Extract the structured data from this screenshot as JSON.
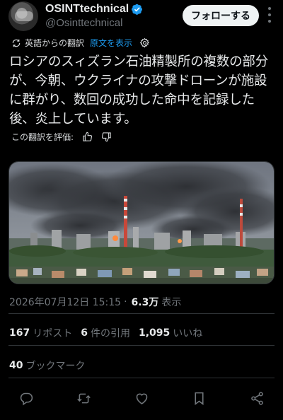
{
  "author": {
    "name": "OSINTtechnical",
    "handle": "@Osinttechnical",
    "verified": true,
    "follow_label": "フォローする"
  },
  "translation": {
    "label": "英語からの翻訳",
    "show_original": "原文を表示",
    "rate_label": "この翻訳を評価:"
  },
  "tweet": {
    "text": "ロシアのスィズラン石油精製所の複数の部分が、今朝、ウクライナの攻撃ドローンが施設に群がり、数回の成功した命中を記録した後、炎上しています。"
  },
  "meta": {
    "timestamp": "2026年07月12日 15:15",
    "separator": "·",
    "views_count": "6.3万",
    "views_label": "表示"
  },
  "stats": {
    "reposts_count": "167",
    "reposts_label": "リポスト",
    "quotes_count": "6",
    "quotes_label": "件の引用",
    "likes_count": "1,095",
    "likes_label": "いいね",
    "bookmarks_count": "40",
    "bookmarks_label": "ブックマーク"
  },
  "icons": {
    "verified": "verified-badge-icon",
    "more": "more-icon",
    "translate": "translate-icon",
    "settings": "gear-icon",
    "thumb_up": "thumb-up-icon",
    "thumb_down": "thumb-down-icon",
    "reply": "reply-icon",
    "repost": "repost-icon",
    "like": "like-icon",
    "bookmark": "bookmark-icon",
    "share": "share-icon"
  },
  "colors": {
    "background": "#000000",
    "text": "#e7e9ea",
    "secondary": "#71767b",
    "link": "#1d9bf0",
    "divider": "#2f3336"
  }
}
